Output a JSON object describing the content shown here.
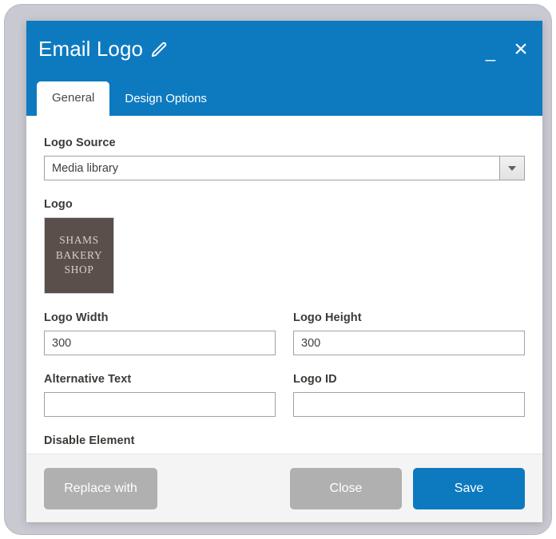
{
  "window": {
    "title": "Email Logo",
    "edit_icon": "pencil-icon",
    "minimize_label": "_",
    "close_label": "×",
    "header_color": "#0d7ac0"
  },
  "tabs": [
    {
      "label": "General",
      "active": true
    },
    {
      "label": "Design Options",
      "active": false
    }
  ],
  "form": {
    "logo_source": {
      "label": "Logo Source",
      "value": "Media library",
      "dropdown_icon": "chevron-down-icon"
    },
    "logo": {
      "label": "Logo",
      "thumbnail_lines": [
        "SHAMS",
        "BAKERY",
        "SHOP"
      ],
      "thumbnail_bg": "#5a4f4a",
      "thumbnail_text_color": "#d9d0c5"
    },
    "logo_width": {
      "label": "Logo Width",
      "value": "300",
      "placeholder": ""
    },
    "logo_height": {
      "label": "Logo Height",
      "value": "300",
      "placeholder": ""
    },
    "alternative_text": {
      "label": "Alternative Text",
      "value": "",
      "placeholder": ""
    },
    "logo_id": {
      "label": "Logo ID",
      "value": "",
      "placeholder": ""
    },
    "disable_element": {
      "label": "Disable Element"
    }
  },
  "footer": {
    "replace_with_label": "Replace with",
    "close_label": "Close",
    "save_label": "Save",
    "save_color": "#0d7ac0",
    "gray_color": "#b0b0b0"
  }
}
